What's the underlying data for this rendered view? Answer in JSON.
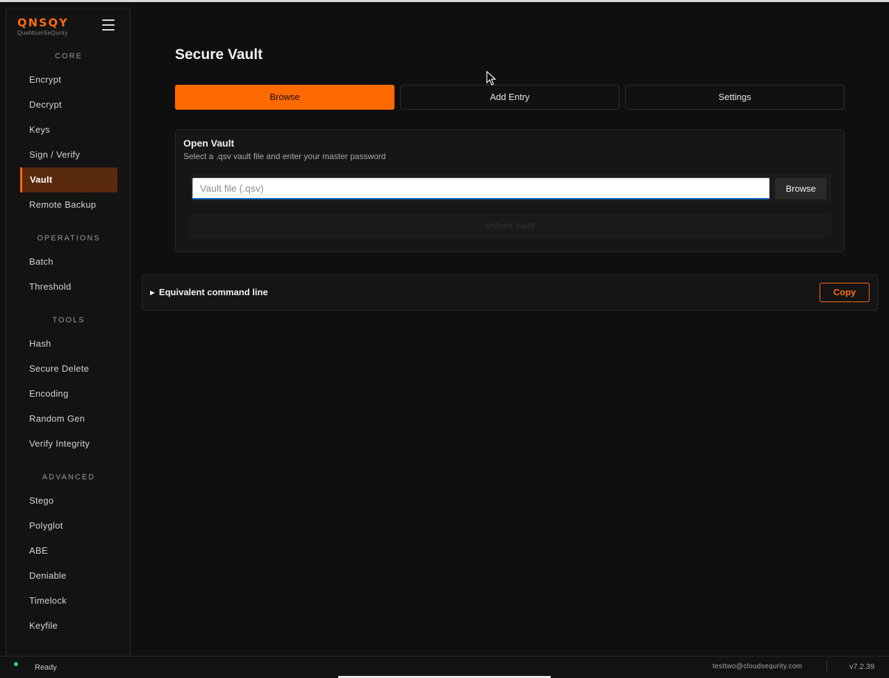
{
  "logo": {
    "name": "QNSQY",
    "tagline": "QuaNtumSeQurity"
  },
  "sidebar": {
    "sections": {
      "core": "CORE",
      "operations": "OPERATIONS",
      "tools": "TOOLS",
      "advanced": "ADVANCED"
    },
    "items": [
      "Encrypt",
      "Decrypt",
      "Keys",
      "Sign / Verify",
      "Vault",
      "Remote Backup",
      "Batch",
      "Threshold",
      "Hash",
      "Secure Delete",
      "Encoding",
      "Random Gen",
      "Verify Integrity",
      "Stego",
      "Polyglot",
      "ABE",
      "Deniable",
      "Timelock",
      "Keyfile"
    ],
    "active_item": "Vault"
  },
  "page": {
    "title": "Secure Vault"
  },
  "tabs": [
    "Browse",
    "Add Entry",
    "Settings"
  ],
  "active_tab": "Browse",
  "open_vault": {
    "title": "Open Vault",
    "subtitle": "Select a .qsv vault file and enter your master password",
    "file_placeholder": "Vault file (.qsv)",
    "file_value": "",
    "browse_label": "Browse",
    "unlock_label": "Unlock Vault"
  },
  "command_line": {
    "label": "Equivalent command line",
    "copy_label": "Copy"
  },
  "status": {
    "text": "Ready",
    "user": "testtwo@cloudsequrity.com",
    "version": "v7.2.39"
  },
  "colors": {
    "accent": "#ff6a00",
    "background": "#0f0f0f",
    "status_ok": "#2ecc5c"
  },
  "icons": [
    "hamburger-menu-icon",
    "status-dot-icon",
    "expand-triangle-icon",
    "mouse-cursor-icon"
  ]
}
